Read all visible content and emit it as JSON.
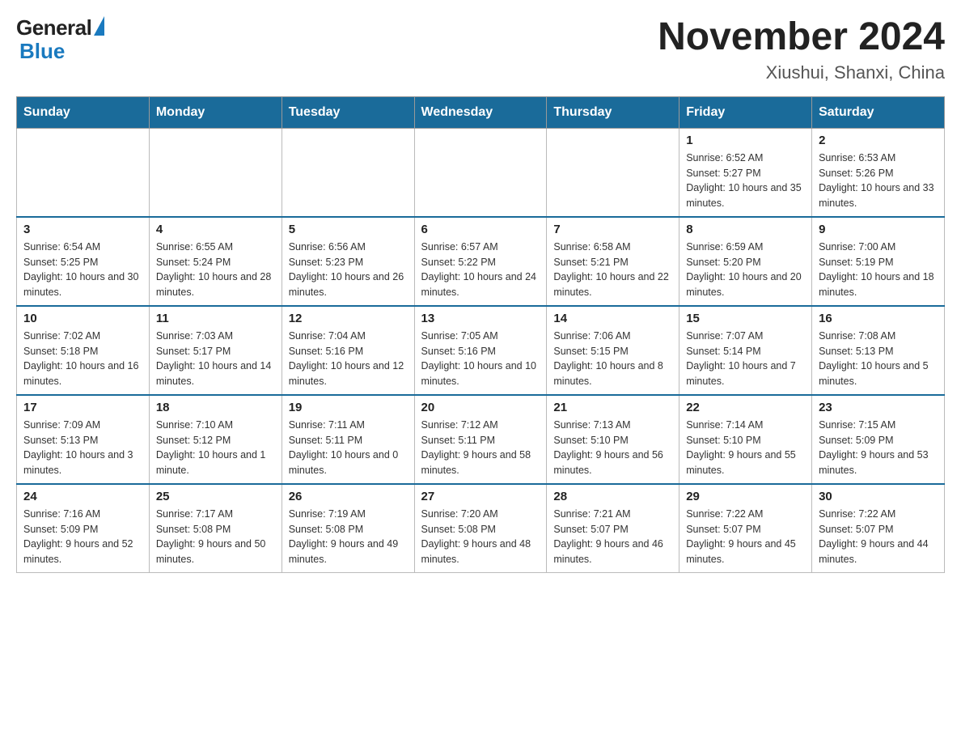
{
  "logo": {
    "general": "General",
    "triangle_symbol": "▶",
    "blue": "Blue"
  },
  "header": {
    "title": "November 2024",
    "subtitle": "Xiushui, Shanxi, China"
  },
  "days_of_week": [
    "Sunday",
    "Monday",
    "Tuesday",
    "Wednesday",
    "Thursday",
    "Friday",
    "Saturday"
  ],
  "weeks": [
    {
      "days": [
        {
          "num": "",
          "info": ""
        },
        {
          "num": "",
          "info": ""
        },
        {
          "num": "",
          "info": ""
        },
        {
          "num": "",
          "info": ""
        },
        {
          "num": "",
          "info": ""
        },
        {
          "num": "1",
          "info": "Sunrise: 6:52 AM\nSunset: 5:27 PM\nDaylight: 10 hours and 35 minutes."
        },
        {
          "num": "2",
          "info": "Sunrise: 6:53 AM\nSunset: 5:26 PM\nDaylight: 10 hours and 33 minutes."
        }
      ]
    },
    {
      "days": [
        {
          "num": "3",
          "info": "Sunrise: 6:54 AM\nSunset: 5:25 PM\nDaylight: 10 hours and 30 minutes."
        },
        {
          "num": "4",
          "info": "Sunrise: 6:55 AM\nSunset: 5:24 PM\nDaylight: 10 hours and 28 minutes."
        },
        {
          "num": "5",
          "info": "Sunrise: 6:56 AM\nSunset: 5:23 PM\nDaylight: 10 hours and 26 minutes."
        },
        {
          "num": "6",
          "info": "Sunrise: 6:57 AM\nSunset: 5:22 PM\nDaylight: 10 hours and 24 minutes."
        },
        {
          "num": "7",
          "info": "Sunrise: 6:58 AM\nSunset: 5:21 PM\nDaylight: 10 hours and 22 minutes."
        },
        {
          "num": "8",
          "info": "Sunrise: 6:59 AM\nSunset: 5:20 PM\nDaylight: 10 hours and 20 minutes."
        },
        {
          "num": "9",
          "info": "Sunrise: 7:00 AM\nSunset: 5:19 PM\nDaylight: 10 hours and 18 minutes."
        }
      ]
    },
    {
      "days": [
        {
          "num": "10",
          "info": "Sunrise: 7:02 AM\nSunset: 5:18 PM\nDaylight: 10 hours and 16 minutes."
        },
        {
          "num": "11",
          "info": "Sunrise: 7:03 AM\nSunset: 5:17 PM\nDaylight: 10 hours and 14 minutes."
        },
        {
          "num": "12",
          "info": "Sunrise: 7:04 AM\nSunset: 5:16 PM\nDaylight: 10 hours and 12 minutes."
        },
        {
          "num": "13",
          "info": "Sunrise: 7:05 AM\nSunset: 5:16 PM\nDaylight: 10 hours and 10 minutes."
        },
        {
          "num": "14",
          "info": "Sunrise: 7:06 AM\nSunset: 5:15 PM\nDaylight: 10 hours and 8 minutes."
        },
        {
          "num": "15",
          "info": "Sunrise: 7:07 AM\nSunset: 5:14 PM\nDaylight: 10 hours and 7 minutes."
        },
        {
          "num": "16",
          "info": "Sunrise: 7:08 AM\nSunset: 5:13 PM\nDaylight: 10 hours and 5 minutes."
        }
      ]
    },
    {
      "days": [
        {
          "num": "17",
          "info": "Sunrise: 7:09 AM\nSunset: 5:13 PM\nDaylight: 10 hours and 3 minutes."
        },
        {
          "num": "18",
          "info": "Sunrise: 7:10 AM\nSunset: 5:12 PM\nDaylight: 10 hours and 1 minute."
        },
        {
          "num": "19",
          "info": "Sunrise: 7:11 AM\nSunset: 5:11 PM\nDaylight: 10 hours and 0 minutes."
        },
        {
          "num": "20",
          "info": "Sunrise: 7:12 AM\nSunset: 5:11 PM\nDaylight: 9 hours and 58 minutes."
        },
        {
          "num": "21",
          "info": "Sunrise: 7:13 AM\nSunset: 5:10 PM\nDaylight: 9 hours and 56 minutes."
        },
        {
          "num": "22",
          "info": "Sunrise: 7:14 AM\nSunset: 5:10 PM\nDaylight: 9 hours and 55 minutes."
        },
        {
          "num": "23",
          "info": "Sunrise: 7:15 AM\nSunset: 5:09 PM\nDaylight: 9 hours and 53 minutes."
        }
      ]
    },
    {
      "days": [
        {
          "num": "24",
          "info": "Sunrise: 7:16 AM\nSunset: 5:09 PM\nDaylight: 9 hours and 52 minutes."
        },
        {
          "num": "25",
          "info": "Sunrise: 7:17 AM\nSunset: 5:08 PM\nDaylight: 9 hours and 50 minutes."
        },
        {
          "num": "26",
          "info": "Sunrise: 7:19 AM\nSunset: 5:08 PM\nDaylight: 9 hours and 49 minutes."
        },
        {
          "num": "27",
          "info": "Sunrise: 7:20 AM\nSunset: 5:08 PM\nDaylight: 9 hours and 48 minutes."
        },
        {
          "num": "28",
          "info": "Sunrise: 7:21 AM\nSunset: 5:07 PM\nDaylight: 9 hours and 46 minutes."
        },
        {
          "num": "29",
          "info": "Sunrise: 7:22 AM\nSunset: 5:07 PM\nDaylight: 9 hours and 45 minutes."
        },
        {
          "num": "30",
          "info": "Sunrise: 7:22 AM\nSunset: 5:07 PM\nDaylight: 9 hours and 44 minutes."
        }
      ]
    }
  ]
}
